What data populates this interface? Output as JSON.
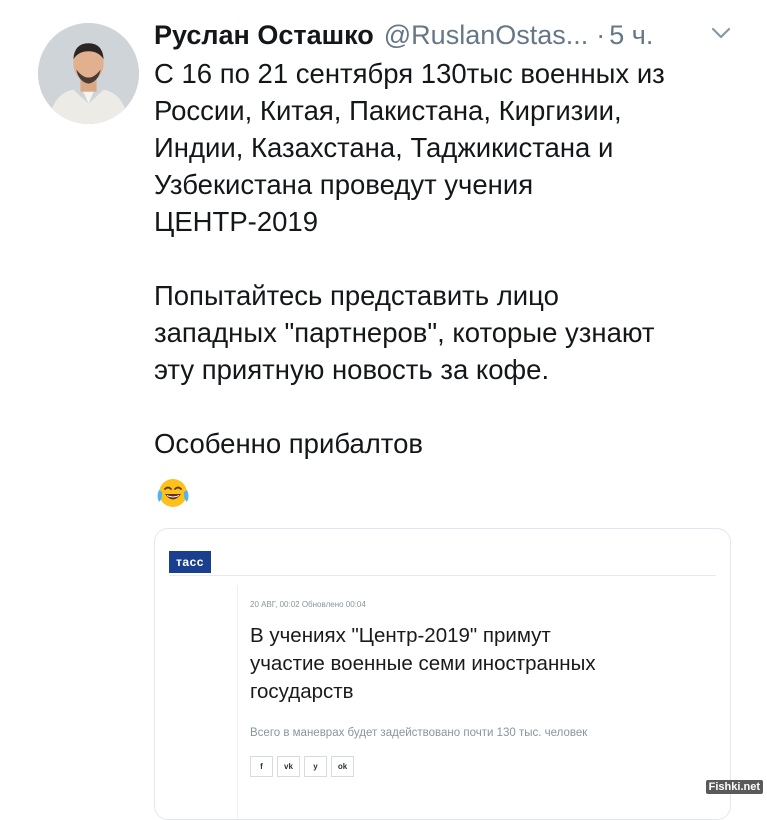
{
  "tweet": {
    "author_name": "Руслан Осташко",
    "handle": "@RuslanOstas...",
    "separator": "·",
    "time": "5 ч.",
    "paragraphs": [
      [
        "С 16 по 21 сентября 130тыс военных из",
        "России, Китая, Пакистана, Киргизии,",
        "Индии, Казахстана, Таджикистана и",
        "Узбекистана проведут учения",
        "ЦЕНТР-2019"
      ],
      [
        "Попытайтесь представить лицо",
        "западных \"партнеров\", которые узнают",
        "эту приятную новость за кофе."
      ],
      [
        "Особенно прибалтов"
      ]
    ],
    "emoji_icon": "face-with-tears-of-joy-icon",
    "menu_icon": "chevron-down-icon"
  },
  "card": {
    "logo": "тасс",
    "date": "20 АВГ, 00:02  Обновлено 00:04",
    "headline": [
      "В учениях \"Центр-2019\" примут",
      "участие военные семи иностранных",
      "государств"
    ],
    "subtitle": "Всего в маневрах будет задействовано почти 130 тыс. человек",
    "share": [
      {
        "label": "f",
        "icon": "facebook-icon"
      },
      {
        "label": "vk",
        "icon": "vk-icon"
      },
      {
        "label": "y",
        "icon": "twitter-icon"
      },
      {
        "label": "ok",
        "icon": "odnoklassniki-icon"
      }
    ]
  },
  "watermark": "Fishki.net",
  "colors": {
    "text": "#14171a",
    "secondary": "#657786",
    "tass_blue": "#1b3f8f",
    "card_border": "#e1e8ed"
  }
}
